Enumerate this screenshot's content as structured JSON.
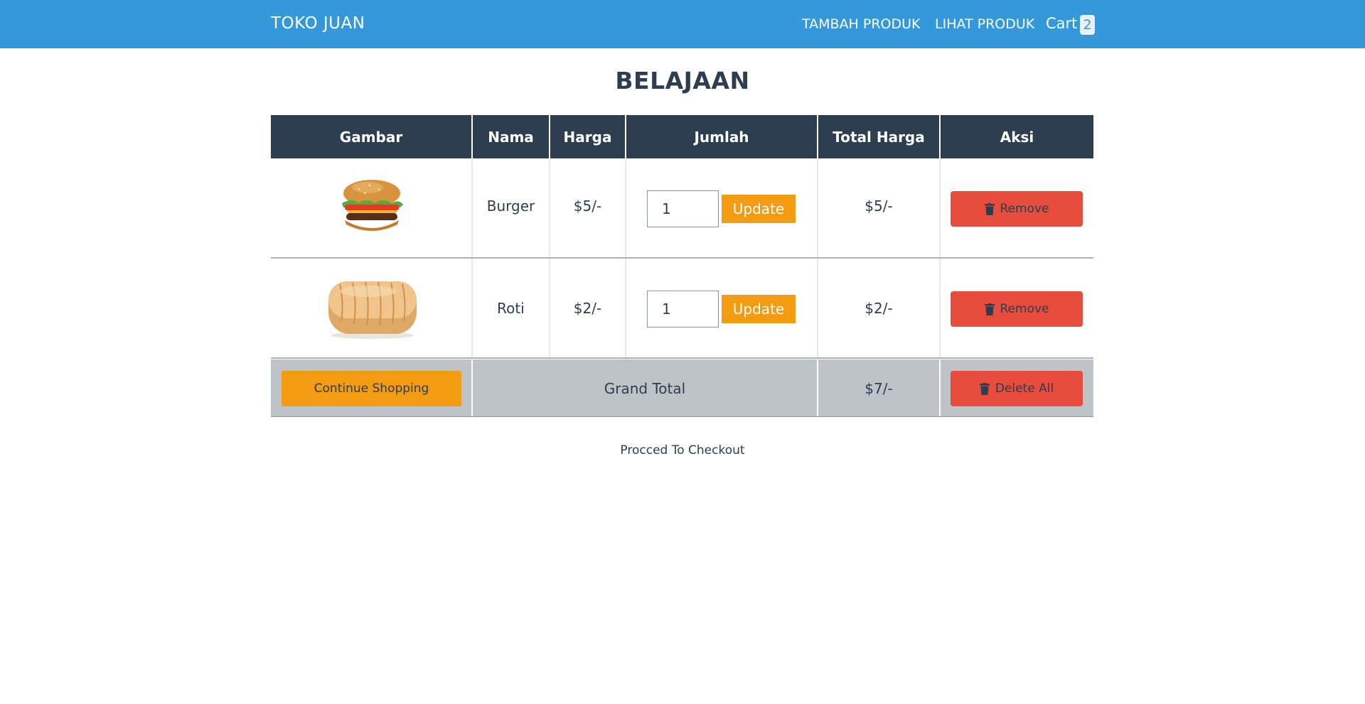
{
  "navbar": {
    "brand": "TOKO JUAN",
    "links": [
      {
        "label": "TAMBAH PRODUK"
      },
      {
        "label": "LIHAT PRODUK"
      }
    ],
    "cart_label": "Cart",
    "cart_count": "2"
  },
  "page": {
    "title": "BELAJAAN"
  },
  "table": {
    "headers": [
      "Gambar",
      "Nama",
      "Harga",
      "Jumlah",
      "Total Harga",
      "Aksi"
    ],
    "rows": [
      {
        "image_icon": "burger-image",
        "name": "Burger",
        "price": "$5/-",
        "quantity": "1",
        "update_label": "Update",
        "total": "$5/-",
        "remove_label": "Remove"
      },
      {
        "image_icon": "bread-image",
        "name": "Roti",
        "price": "$2/-",
        "quantity": "1",
        "update_label": "Update",
        "total": "$2/-",
        "remove_label": "Remove"
      }
    ],
    "footer": {
      "continue_label": "Continue Shopping",
      "grand_total_label": "Grand Total",
      "grand_total_value": "$7/-",
      "delete_all_label": "Delete All"
    }
  },
  "checkout": {
    "label": "Procced To Checkout"
  },
  "colors": {
    "navbar": "#3498db",
    "header": "#2c3e50",
    "update": "#f39c12",
    "remove": "#e74c3c",
    "footer_row": "#bdc3c7"
  }
}
